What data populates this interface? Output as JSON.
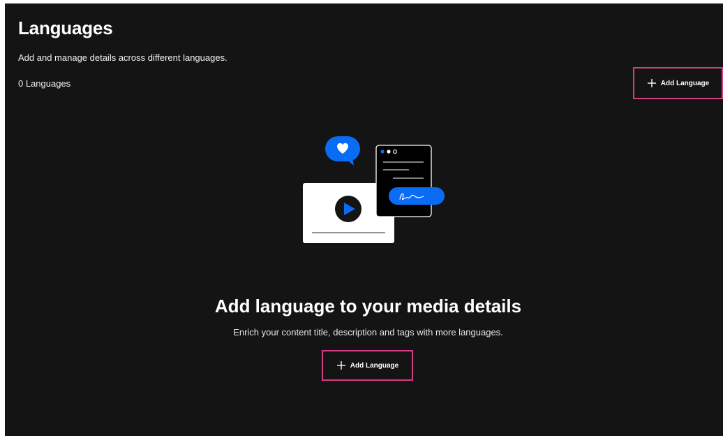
{
  "header": {
    "title": "Languages",
    "subtitle": "Add and manage details across different languages.",
    "count_label": "0 Languages",
    "add_button_label": "Add Language"
  },
  "empty_state": {
    "title": "Add language to your media details",
    "description": "Enrich your content title, description and tags with more languages.",
    "add_button_label": "Add Language",
    "illustration_icons": [
      "heart-chat-bubble-icon",
      "document-window-icon",
      "video-player-icon",
      "signature-pill-icon"
    ]
  },
  "colors": {
    "background": "#141414",
    "accent_blue": "#0a6cf5",
    "highlight_border": "#d63b86",
    "text": "#ffffff"
  }
}
